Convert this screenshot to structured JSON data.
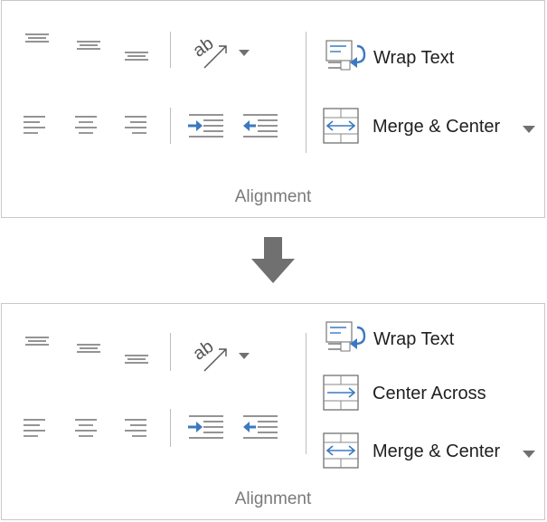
{
  "panels": [
    {
      "group_title": "Alignment",
      "wrap_text_label": "Wrap Text",
      "merge_center_label": "Merge & Center"
    },
    {
      "group_title": "Alignment",
      "wrap_text_label": "Wrap Text",
      "center_across_label": "Center Across",
      "merge_center_label": "Merge & Center"
    }
  ],
  "colors": {
    "accent_blue": "#3b78c2",
    "icon_gray": "#555555",
    "arrow_gray": "#707070",
    "border": "#c8c8c8"
  },
  "icons": {
    "top_align": "align-top-icon",
    "middle_align": "align-middle-icon",
    "bottom_align": "align-bottom-icon",
    "orientation": "orientation-icon",
    "left_align": "align-left-icon",
    "center_align": "align-center-icon",
    "right_align": "align-right-icon",
    "decrease_indent": "decrease-indent-icon",
    "increase_indent": "increase-indent-icon",
    "wrap_text": "wrap-text-icon",
    "center_across": "center-across-icon",
    "merge_center": "merge-center-icon",
    "down_arrow": "down-arrow-icon"
  }
}
